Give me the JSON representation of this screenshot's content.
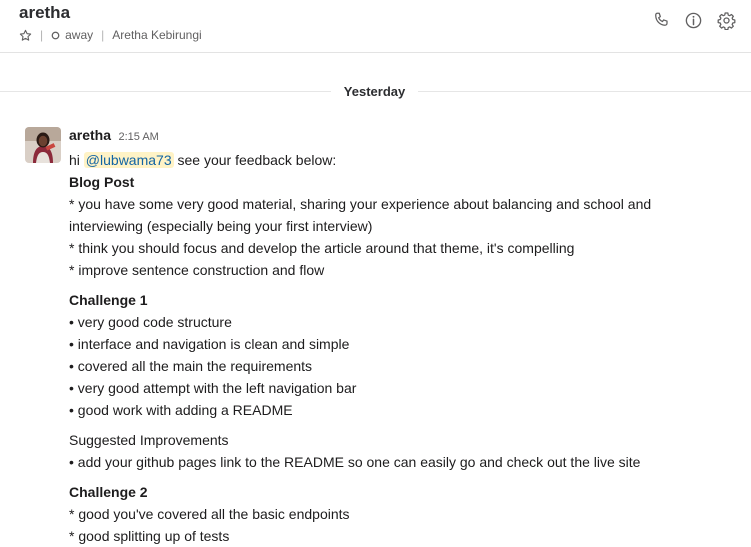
{
  "header": {
    "channel_name": "aretha",
    "status": "away",
    "full_name": "Aretha Kebirungi",
    "separator": "|",
    "icons": [
      "star-icon",
      "presence-icon",
      "phone-icon",
      "info-icon",
      "gear-icon"
    ]
  },
  "divider": {
    "label": "Yesterday"
  },
  "message": {
    "sender": "aretha",
    "time": "2:15 AM",
    "greeting_prefix": "hi ",
    "mention": "@lubwama73",
    "greeting_suffix": " see your feedback below:",
    "blog_title": "Blog Post",
    "blog_1": "* you have some very good material, sharing your experience about balancing and school and interviewing (especially being your first interview)",
    "blog_2": "* think you should focus and develop the article around that theme, it's compelling",
    "blog_3": "* improve sentence construction and flow",
    "challenge1_title": "Challenge 1",
    "c1_1": "• very good code structure",
    "c1_2": "• interface and navigation is clean and simple",
    "c1_3": "• covered all the main the requirements",
    "c1_4": "• very good attempt with the left navigation bar",
    "c1_5": "• good work with adding a README",
    "suggested_title": "Suggested Improvements",
    "sugg_1": "• add your github pages link to the README so one can easily go and check out the live site",
    "challenge2_title": "Challenge 2",
    "c2_1": "* good you've covered all the basic endpoints",
    "c2_2": "* good splitting up of tests"
  },
  "colors": {
    "mention_bg": "#fff3c6",
    "mention_text": "#1264a3",
    "text": "#1d1c1d",
    "muted": "#616061"
  }
}
